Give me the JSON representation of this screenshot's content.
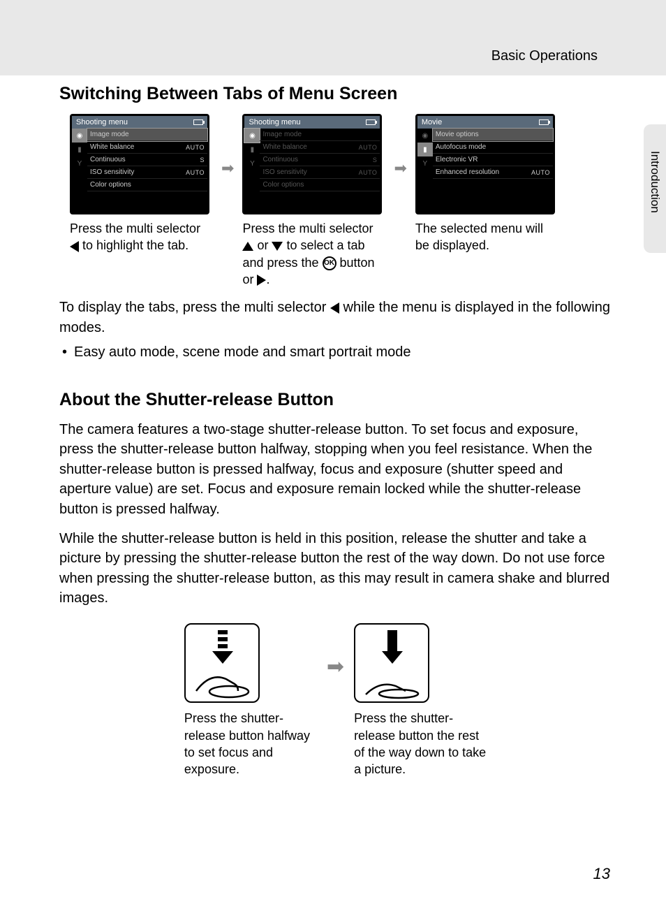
{
  "header": {
    "crumb": "Basic Operations"
  },
  "side_tab": {
    "label": "Introduction"
  },
  "section1": {
    "title": "Switching Between Tabs of Menu Screen",
    "screens": [
      {
        "title": "Shooting menu",
        "items": [
          {
            "label": "Image mode",
            "value": "",
            "sel": true
          },
          {
            "label": "White balance",
            "value": "AUTO"
          },
          {
            "label": "Continuous",
            "value": "S"
          },
          {
            "label": "ISO sensitivity",
            "value": "AUTO"
          },
          {
            "label": "Color options",
            "value": ""
          }
        ],
        "tab_highlight": false,
        "caption_pre": "Press the multi selector ",
        "caption_post": " to highlight the tab."
      },
      {
        "title": "Shooting menu",
        "items": [
          {
            "label": "Image mode",
            "value": "",
            "dim": true
          },
          {
            "label": "White balance",
            "value": "AUTO",
            "dim": true
          },
          {
            "label": "Continuous",
            "value": "S",
            "dim": true
          },
          {
            "label": "ISO sensitivity",
            "value": "AUTO",
            "dim": true
          },
          {
            "label": "Color options",
            "value": "",
            "dim": true
          }
        ],
        "tab_highlight": true,
        "caption_pre": "Press the multi selector ",
        "caption_mid": " or ",
        "caption_post1": " to select a tab and press the ",
        "caption_post2": " button or ",
        "caption_post3": "."
      },
      {
        "title": "Movie",
        "items": [
          {
            "label": "Movie options",
            "value": "",
            "sel": true
          },
          {
            "label": "Autofocus mode",
            "value": ""
          },
          {
            "label": "Electronic VR",
            "value": ""
          },
          {
            "label": "Enhanced resolution",
            "value": "AUTO"
          }
        ],
        "tab_highlight": false,
        "caption_pre": "The selected menu will be displayed."
      }
    ],
    "para_pre": "To display the tabs, press the multi selector ",
    "para_post": " while the menu is displayed in the following modes.",
    "bullet": "Easy auto mode, scene mode and smart portrait mode"
  },
  "section2": {
    "title": "About the Shutter-release Button",
    "para1": "The camera features a two-stage shutter-release button. To set focus and exposure, press the shutter-release button halfway, stopping when you feel resistance. When the shutter-release button is pressed halfway, focus and exposure (shutter speed and aperture value) are set. Focus and exposure remain locked while the shutter-release button is pressed halfway.",
    "para2": "While the shutter-release button is held in this position, release the shutter and take a picture by pressing the shutter-release button the rest of the way down. Do not use force when pressing the shutter-release button, as this may result in camera shake and blurred images.",
    "shutter": [
      {
        "caption": "Press the shutter-release button halfway to set focus and exposure."
      },
      {
        "caption": "Press the shutter-release button the rest of the way down to take a picture."
      }
    ]
  },
  "page_number": "13"
}
